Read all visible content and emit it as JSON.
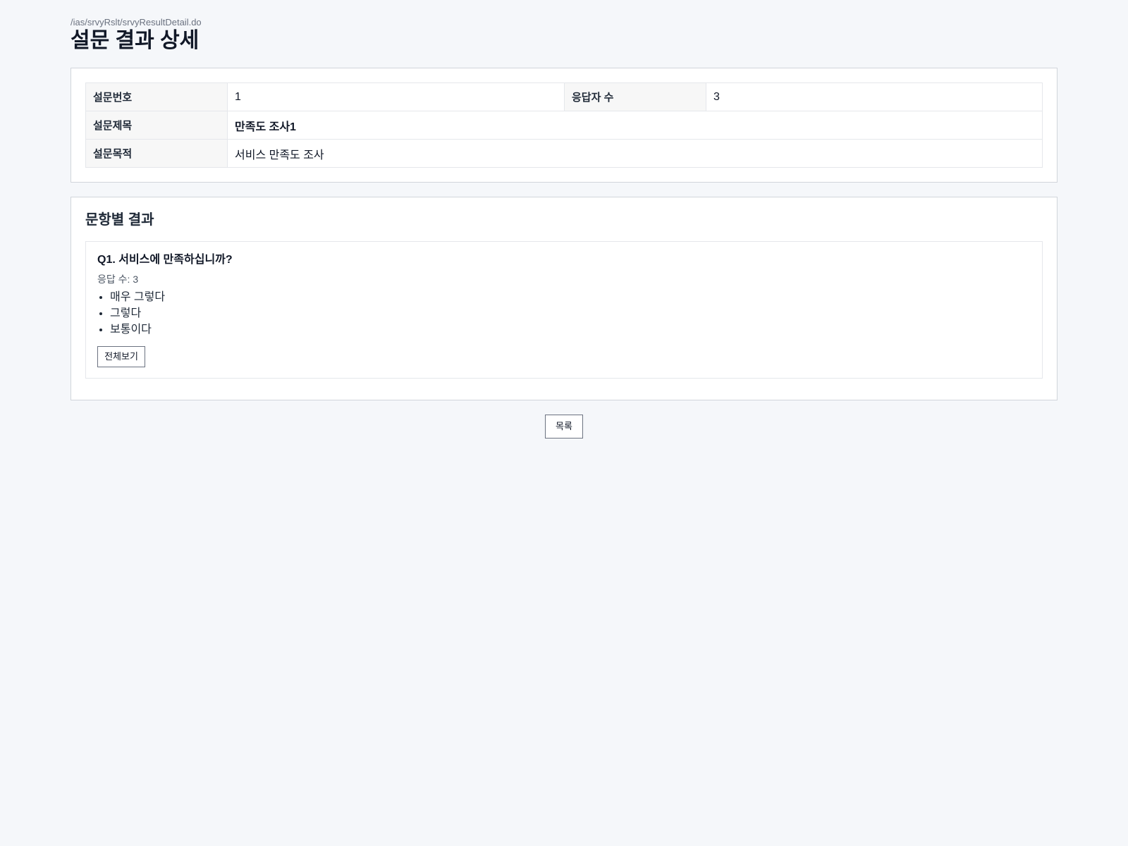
{
  "breadcrumb": "/ias/srvyRslt/srvyResultDetail.do",
  "page_title": "설문 결과 상세",
  "summary": {
    "survey_no_label": "설문번호",
    "survey_no_value": "1",
    "respondents_label": "응답자 수",
    "respondents_value": "3",
    "survey_title_label": "설문제목",
    "survey_title_value": "만족도 조사1",
    "survey_purpose_label": "설문목적",
    "survey_purpose_value": "서비스 만족도 조사"
  },
  "results": {
    "section_title": "문항별 결과",
    "questions": [
      {
        "title": "Q1. 서비스에 만족하십니까?",
        "answer_count_label": "응답 수: ",
        "answer_count_value": "3",
        "answers": [
          "매우 그렇다",
          "그렇다",
          "보통이다"
        ],
        "view_all_label": "전체보기"
      }
    ]
  },
  "actions": {
    "list_label": "목록"
  }
}
